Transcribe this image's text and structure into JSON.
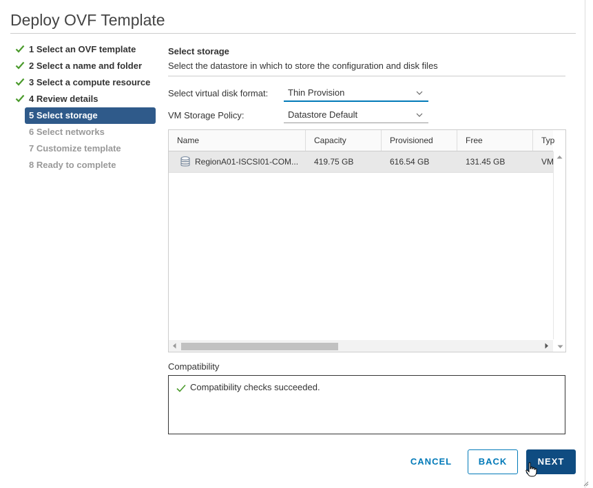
{
  "dialog": {
    "title": "Deploy OVF Template"
  },
  "steps": [
    {
      "label": "1 Select an OVF template",
      "state": "done"
    },
    {
      "label": "2 Select a name and folder",
      "state": "done"
    },
    {
      "label": "3 Select a compute resource",
      "state": "done"
    },
    {
      "label": "4 Review details",
      "state": "done"
    },
    {
      "label": "5 Select storage",
      "state": "active"
    },
    {
      "label": "6 Select networks",
      "state": "pending"
    },
    {
      "label": "7 Customize template",
      "state": "pending"
    },
    {
      "label": "8 Ready to complete",
      "state": "pending"
    }
  ],
  "storage": {
    "title": "Select storage",
    "description": "Select the datastore in which to store the configuration and disk files",
    "disk_format_label": "Select virtual disk format:",
    "disk_format_value": "Thin Provision",
    "policy_label": "VM Storage Policy:",
    "policy_value": "Datastore Default"
  },
  "table": {
    "columns": [
      "Name",
      "Capacity",
      "Provisioned",
      "Free",
      "Typ"
    ],
    "rows": [
      {
        "name": "RegionA01-ISCSI01-COM...",
        "capacity": "419.75 GB",
        "provisioned": "616.54 GB",
        "free": "131.45 GB",
        "type": "VM"
      }
    ]
  },
  "compatibility": {
    "label": "Compatibility",
    "message": "Compatibility checks succeeded."
  },
  "buttons": {
    "cancel": "CANCEL",
    "back": "BACK",
    "next": "NEXT"
  },
  "colors": {
    "active_step_bg": "#2f5a8a",
    "primary": "#0f4c81",
    "link": "#0079b8",
    "check": "#4a9a2b"
  }
}
